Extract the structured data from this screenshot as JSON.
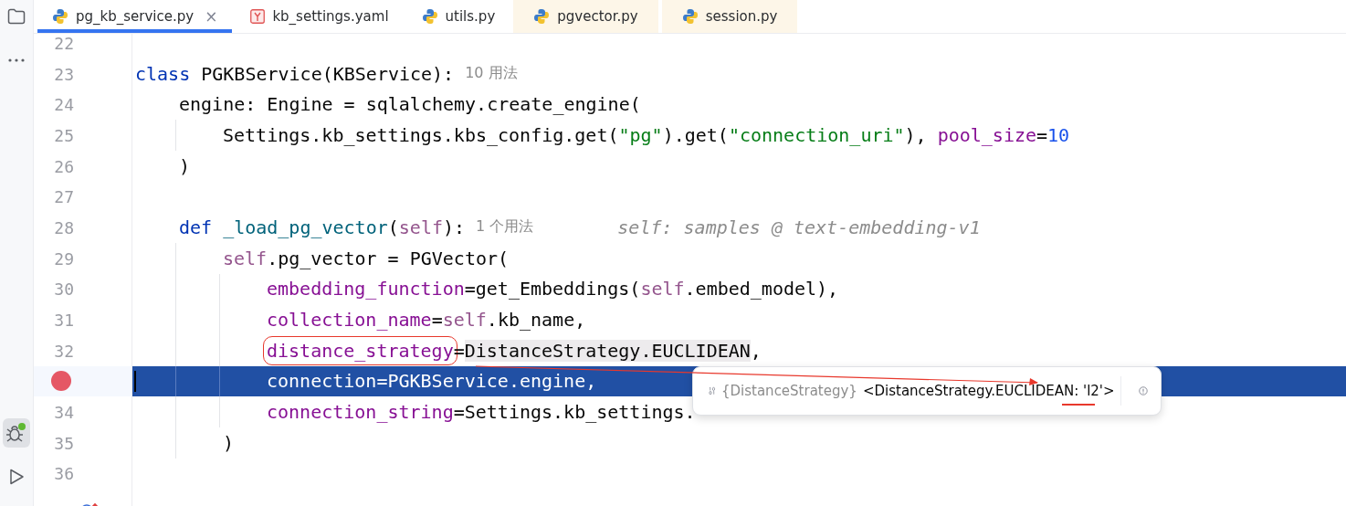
{
  "sidebar": {
    "top": [
      {
        "kind": "folder",
        "selected": false
      },
      {
        "kind": "more",
        "selected": false
      }
    ],
    "bottom": [
      {
        "kind": "debug",
        "selected": true
      },
      {
        "kind": "run",
        "selected": false
      }
    ]
  },
  "tabs": [
    {
      "label": "pg_kb_service.py",
      "kind": "python",
      "selected": true,
      "tinted": false,
      "close": "×"
    },
    {
      "label": "kb_settings.yaml",
      "kind": "yaml",
      "selected": false,
      "tinted": false
    },
    {
      "label": "utils.py",
      "kind": "python",
      "selected": false,
      "tinted": false
    },
    {
      "label": "pgvector.py",
      "kind": "python",
      "selected": false,
      "tinted": true
    },
    {
      "label": "session.py",
      "kind": "python",
      "selected": false,
      "tinted": true
    }
  ],
  "lines": [
    {
      "number": "22",
      "current": false
    },
    {
      "number": "23",
      "current": false,
      "tokens": [
        {
          "t": "class",
          "kind": "keyword"
        },
        {
          "t": "PGKBService(KBService):",
          "kind": "plain"
        },
        {
          "t": "10 用法",
          "kind": "hint"
        }
      ],
      "children": [
        {
          "number": "24",
          "current": false,
          "tokens": [
            {
              "t": "engine: Engine = sqlalchemy.create_engine(",
              "kind": "plain"
            }
          ],
          "children": [
            {
              "number": "25",
              "current": false,
              "tokens": [
                {
                  "t": "Settings.kb_settings.kbs_config.get(",
                  "kind": "plain"
                },
                {
                  "t": "\"pg\"",
                  "kind": "string"
                },
                {
                  "t": ").get(",
                  "kind": "plain"
                },
                {
                  "t": "\"connection_uri\"",
                  "kind": "string"
                },
                {
                  "t": "),",
                  "kind": "plain"
                },
                {
                  "t": "pool_size",
                  "kind": "param"
                },
                {
                  "t": "=",
                  "kind": "plain"
                },
                {
                  "t": "10",
                  "kind": "number"
                }
              ]
            }
          ]
        },
        {
          "number": "26",
          "current": false,
          "tokens": [
            {
              "t": ")",
              "kind": "plain"
            }
          ]
        },
        {
          "number": "27",
          "current": false
        },
        {
          "number": "28",
          "current": false,
          "tokens": [
            {
              "t": "def",
              "kind": "keyword"
            },
            {
              "t": "_load_pg_vector",
              "kind": "function"
            },
            {
              "t": "(",
              "kind": "plain"
            },
            {
              "t": "self",
              "kind": "self"
            },
            {
              "t": "):",
              "kind": "plain"
            },
            {
              "t": "1 个用法",
              "kind": "hint"
            },
            {
              "t": "self: samples @ text-embedding-v1",
              "kind": "debug-value"
            }
          ],
          "children": [
            {
              "number": "29",
              "current": false,
              "tokens": [
                {
                  "t": "self",
                  "kind": "self"
                },
                {
                  "t": ".pg_vector = PGVector(",
                  "kind": "plain"
                }
              ],
              "children": [
                {
                  "number": "30",
                  "current": false,
                  "tokens": [
                    {
                      "t": "embedding_function",
                      "kind": "param"
                    },
                    {
                      "t": "=get_Embeddings(",
                      "kind": "plain"
                    },
                    {
                      "t": "self",
                      "kind": "self"
                    },
                    {
                      "t": ".embed_model),",
                      "kind": "plain"
                    }
                  ]
                },
                {
                  "number": "31",
                  "current": false,
                  "tokens": [
                    {
                      "t": "collection_name",
                      "kind": "param"
                    },
                    {
                      "t": "=",
                      "kind": "plain"
                    },
                    {
                      "t": "self",
                      "kind": "self"
                    },
                    {
                      "t": ".kb_name,",
                      "kind": "plain"
                    }
                  ]
                },
                {
                  "number": "32",
                  "current": false,
                  "tokens": [
                    {
                      "t": "distance_strategy",
                      "kind": "boxed-param"
                    },
                    {
                      "t": "=",
                      "kind": "plain"
                    },
                    {
                      "t": "DistanceStrategy.EUCLIDEAN",
                      "kind": "highlighted"
                    },
                    {
                      "t": ",",
                      "kind": "plain"
                    }
                  ]
                },
                {
                  "kind": "breakpoint",
                  "current": true,
                  "tokens": [
                    {
                      "t": "connection=PGKBService.engine,",
                      "kind": "plain"
                    }
                  ]
                },
                {
                  "number": "34",
                  "current": false,
                  "tokens": [
                    {
                      "t": "connection_string",
                      "kind": "param"
                    },
                    {
                      "t": "=Settings.kb_settings.",
                      "kind": "plain"
                    }
                  ]
                }
              ]
            },
            {
              "number": "35",
              "current": false,
              "tokens": [
                {
                  "t": ")",
                  "kind": "plain"
                }
              ]
            }
          ]
        },
        {
          "number": "36",
          "current": false
        },
        {
          "kind": "override",
          "current": false
        }
      ]
    }
  ],
  "popup": {
    "type": "{DistanceStrategy}",
    "value": "<DistanceStrategy.EUCLIDEAN: 'l2'>"
  }
}
